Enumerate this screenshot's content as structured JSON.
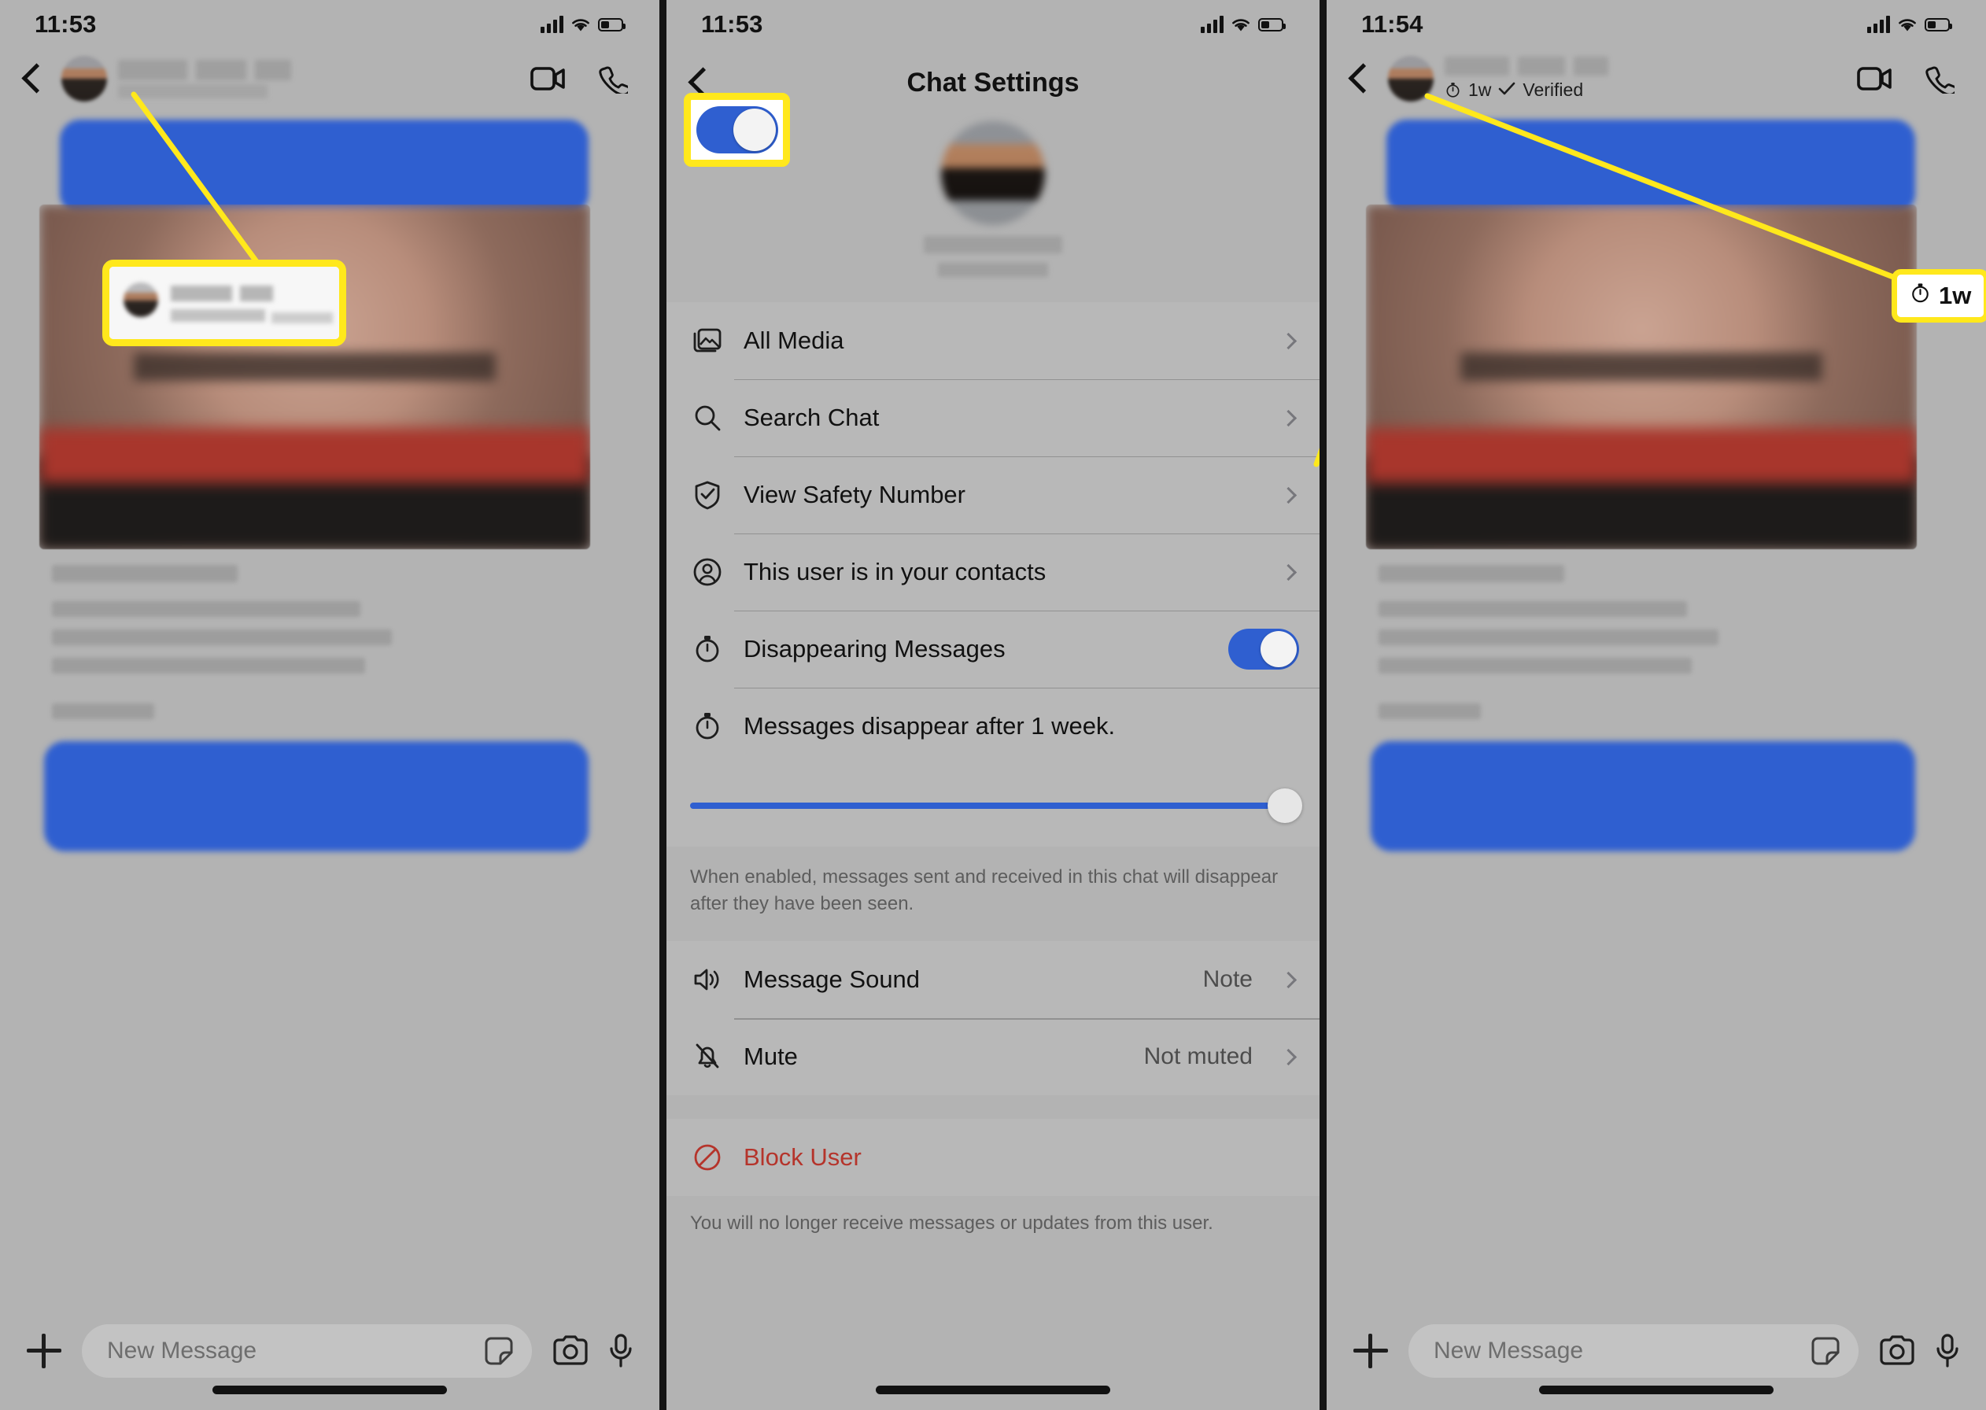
{
  "panels": [
    {
      "id": "chat-before",
      "status": {
        "time": "11:53",
        "signal": "cellular-signal-icon",
        "wifi": "wifi-icon",
        "battery": "battery-icon"
      },
      "nav": {
        "back": "back-chevron-icon",
        "contact_name_redacted": true,
        "video_call": "video-camera-icon",
        "voice_call": "phone-icon"
      },
      "composer": {
        "add": "plus-icon",
        "placeholder": "New Message",
        "sticker": "sticker-icon",
        "camera": "camera-icon",
        "mic": "microphone-icon"
      },
      "callout": {
        "type": "magnified-header",
        "content_redacted": true
      }
    },
    {
      "id": "chat-settings",
      "status": {
        "time": "11:53"
      },
      "nav": {
        "back": "back-chevron-icon",
        "title": "Chat Settings"
      },
      "profile": {
        "avatar": "contact-avatar",
        "name_redacted": true,
        "subtitle_redacted": true
      },
      "rows_primary": [
        {
          "icon": "photo-stack-icon",
          "label": "All Media",
          "value": "",
          "accessory": "chevron"
        },
        {
          "icon": "magnifier-icon",
          "label": "Search Chat",
          "value": "",
          "accessory": "chevron"
        },
        {
          "icon": "shield-check-icon",
          "label": "View Safety Number",
          "value": "",
          "accessory": "chevron"
        },
        {
          "icon": "person-circle-icon",
          "label": "This user is in your contacts",
          "value": "",
          "accessory": "chevron"
        },
        {
          "icon": "stopwatch-icon",
          "label": "Disappearing Messages",
          "value": "",
          "accessory": "toggle",
          "toggle_on": true
        },
        {
          "icon": "stopwatch-icon",
          "label": "Messages disappear after 1 week.",
          "value": "",
          "accessory": "none"
        }
      ],
      "slider": {
        "value_label": "1 week",
        "percent": 100
      },
      "footnote_disappearing": "When enabled, messages sent and received in this chat will disappear after they have been seen.",
      "rows_notifications": [
        {
          "icon": "speaker-icon",
          "label": "Message Sound",
          "value": "Note",
          "accessory": "chevron"
        },
        {
          "icon": "bell-slash-icon",
          "label": "Mute",
          "value": "Not muted",
          "accessory": "chevron"
        }
      ],
      "rows_danger": [
        {
          "icon": "block-icon",
          "label": "Block User",
          "value": "",
          "accessory": "none"
        }
      ],
      "footnote_block": "You will no longer receive messages or updates from this user.",
      "callout": {
        "type": "toggle-highlight",
        "target": "disappearing-messages-toggle",
        "state_on": true
      }
    },
    {
      "id": "chat-after",
      "status": {
        "time": "11:54"
      },
      "nav": {
        "back": "back-chevron-icon",
        "contact_name_redacted": true,
        "subtitle_timer": "1w",
        "subtitle_verified": "Verified",
        "verified_check": "check-icon",
        "timer_icon": "stopwatch-icon",
        "video_call": "video-camera-icon",
        "voice_call": "phone-icon"
      },
      "composer": {
        "add": "plus-icon",
        "placeholder": "New Message",
        "sticker": "sticker-icon",
        "camera": "camera-icon",
        "mic": "microphone-icon"
      },
      "callout": {
        "type": "badge",
        "timer_icon": "stopwatch-icon",
        "label": "1w"
      }
    }
  ],
  "colors": {
    "highlight_yellow": "#ffe81c",
    "accent_blue": "#2f5fd0",
    "danger_red": "#b5342b",
    "panel_bg": "#b3b3b3"
  }
}
